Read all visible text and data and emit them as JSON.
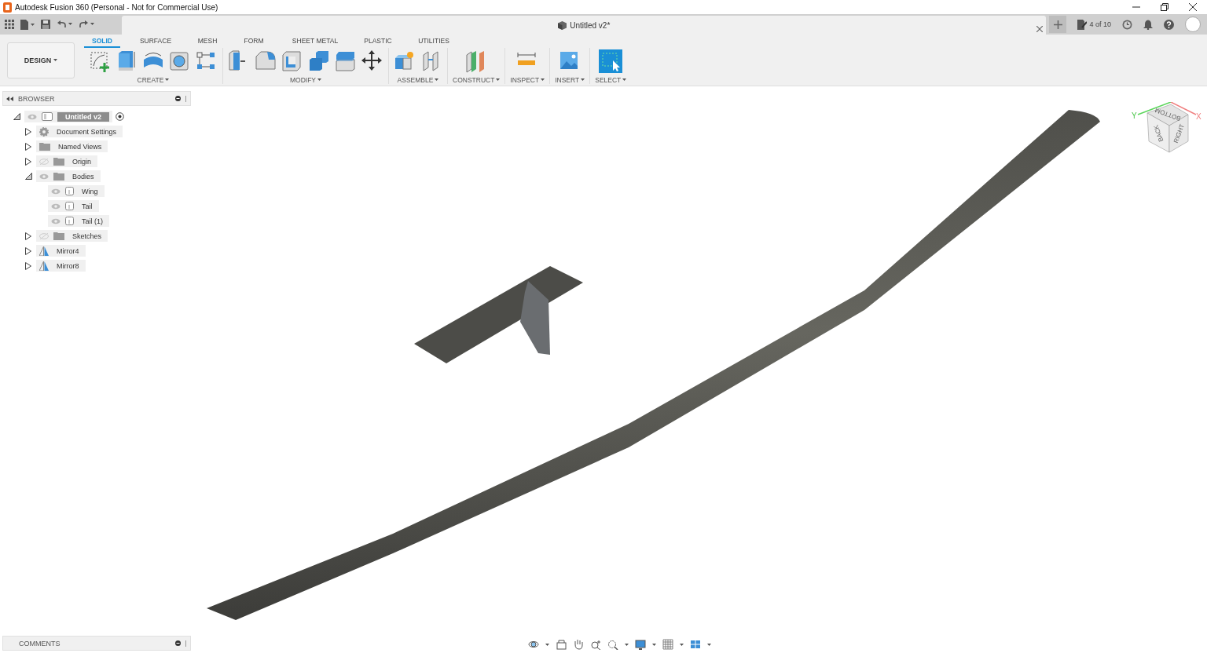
{
  "window": {
    "title": "Autodesk Fusion 360 (Personal - Not for Commercial Use)"
  },
  "document_tab": {
    "title": "Untitled v2*"
  },
  "job_status": "4 of 10",
  "workspace": "DESIGN",
  "ribbon_tabs": [
    {
      "label": "SOLID",
      "selected": true
    },
    {
      "label": "SURFACE",
      "selected": false
    },
    {
      "label": "MESH",
      "selected": false
    },
    {
      "label": "FORM",
      "selected": false
    },
    {
      "label": "SHEET METAL",
      "selected": false
    },
    {
      "label": "PLASTIC",
      "selected": false
    },
    {
      "label": "UTILITIES",
      "selected": false
    }
  ],
  "ribbon_groups": [
    {
      "label": "CREATE"
    },
    {
      "label": "MODIFY"
    },
    {
      "label": "ASSEMBLE"
    },
    {
      "label": "CONSTRUCT"
    },
    {
      "label": "INSPECT"
    },
    {
      "label": "INSERT"
    },
    {
      "label": "SELECT"
    }
  ],
  "browser": {
    "title": "BROWSER",
    "tree": [
      {
        "label": "Untitled v2",
        "kind": "component",
        "visible": true,
        "expanded": true,
        "selected": true,
        "children": [
          {
            "label": "Document Settings",
            "kind": "settings",
            "expanded": false,
            "selected": false
          },
          {
            "label": "Named Views",
            "kind": "folder",
            "expanded": false,
            "selected": false
          },
          {
            "label": "Origin",
            "kind": "folder",
            "visible": false,
            "expanded": false,
            "selected": false
          },
          {
            "label": "Bodies",
            "kind": "folder",
            "visible": true,
            "expanded": true,
            "selected": false,
            "children": [
              {
                "label": "Wing",
                "kind": "body",
                "visible": true,
                "selected": false
              },
              {
                "label": "Tail",
                "kind": "body",
                "visible": true,
                "selected": false
              },
              {
                "label": "Tail (1)",
                "kind": "body",
                "visible": true,
                "selected": false
              }
            ]
          },
          {
            "label": "Sketches",
            "kind": "folder",
            "visible": false,
            "expanded": false,
            "selected": false
          },
          {
            "label": "Mirror4",
            "kind": "mirror",
            "expanded": false,
            "selected": false
          },
          {
            "label": "Mirror8",
            "kind": "mirror",
            "expanded": false,
            "selected": false
          }
        ]
      }
    ]
  },
  "comments": {
    "title": "COMMENTS"
  },
  "viewcube": {
    "faces": [
      "BOTTOM",
      "BACK",
      "RIGHT"
    ],
    "axes": [
      "Y",
      "X"
    ]
  }
}
